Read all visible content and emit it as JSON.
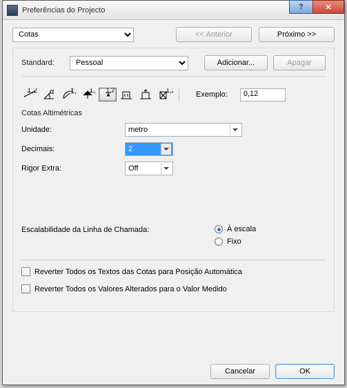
{
  "window": {
    "title": "Preferências do Projecto",
    "help_glyph": "?",
    "close_glyph": "✕"
  },
  "toprow": {
    "category": "Cotas",
    "prev_label": "<< Anterior",
    "next_label": "Próximo >>"
  },
  "standard": {
    "label": "Standard:",
    "value": "Pessoal",
    "add_label": "Adicionar...",
    "delete_label": "Apagar"
  },
  "example": {
    "label": "Exemplo:",
    "value": "0,12"
  },
  "altimetric": {
    "title": "Cotas Altimétricas",
    "unit_label": "Unidade:",
    "unit_value": "metro",
    "decimals_label": "Decimais:",
    "decimals_value": "2",
    "rigor_label": "Rigor Extra:",
    "rigor_value": "Off"
  },
  "escalability": {
    "label": "Escalabilidade da Linha de Chamada:",
    "opt_scale": "À escala",
    "opt_fixed": "Fixo"
  },
  "checks": {
    "revert_text": "Reverter Todos os Textos das Cotas para Posição Automática",
    "revert_values": "Reverter Todos os Valores Alterados para o Valor Medido"
  },
  "footer": {
    "cancel": "Cancelar",
    "ok": "OK"
  },
  "icons": {
    "i1": "linear-dim-icon",
    "i2": "angle-dim-icon",
    "i3": "radial-dim-icon",
    "i4": "level-dim-icon",
    "i5": "elevation-dim-icon",
    "i6": "door-dim-icon",
    "i7": "sill-dim-icon",
    "i8": "area-dim-icon"
  }
}
